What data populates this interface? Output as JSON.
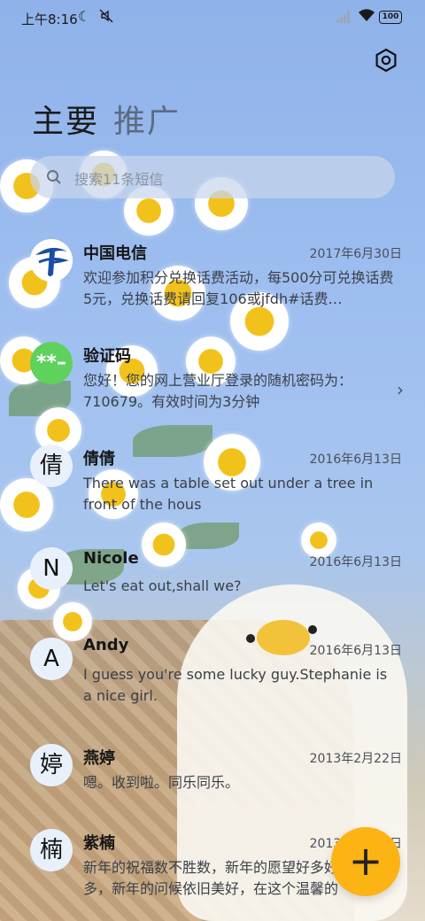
{
  "status_bar": {
    "time": "上午8:16",
    "battery": "100"
  },
  "tabs": {
    "main": "主要",
    "promo": "推广"
  },
  "search": {
    "placeholder": "搜索11条短信"
  },
  "conversations": [
    {
      "name": "中国电信",
      "date": "2017年6月30日",
      "preview": "欢迎参加积分兑换话费活动，每500分可兑换话费5元，兑换话费请回复106或jfdh#话费…",
      "avatar_text": "",
      "avatar_icon": "china-telecom-logo-icon"
    },
    {
      "name": "验证码",
      "date": "",
      "preview": "您好！您的网上营业厅登录的随机密码为：710679。有效时间为3分钟",
      "avatar_text": "**–",
      "avatar_color": "#5fd15d"
    },
    {
      "name": "倩倩",
      "date": "2016年6月13日",
      "preview": "There was a table set out under a tree in front of the hous",
      "avatar_text": "倩"
    },
    {
      "name": "Nicole",
      "date": "2016年6月13日",
      "preview": "Let's eat out,shall we?",
      "avatar_text": "N"
    },
    {
      "name": "Andy",
      "date": "2016年6月13日",
      "preview": "I guess you're some lucky guy.Stephanie is a nice girl.",
      "avatar_text": "A"
    },
    {
      "name": "燕婷",
      "date": "2013年2月22日",
      "preview": "嗯。收到啦。同乐同乐。",
      "avatar_text": "婷"
    },
    {
      "name": "紫楠",
      "date": "2013年2月22日",
      "preview": "新年的祝福数不胜数，新年的愿望好多好多，新年的问候依旧美好，在这个温馨的日子",
      "avatar_text": "楠"
    }
  ],
  "fab": {
    "label": "+"
  },
  "colors": {
    "accent": "#fbb414",
    "avatar_bg": "#e8f1fb"
  }
}
